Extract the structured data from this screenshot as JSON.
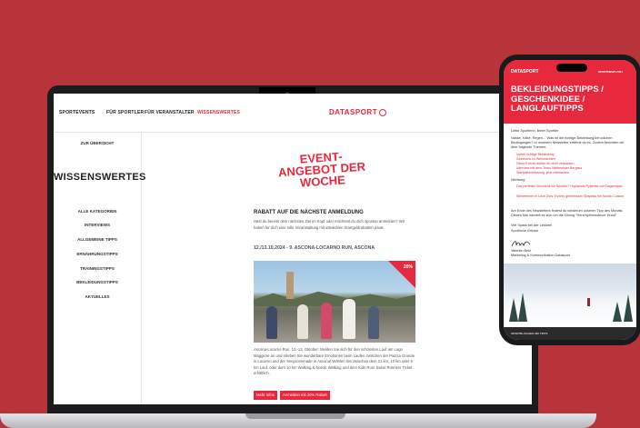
{
  "laptop": {
    "nav": {
      "items": [
        "SPORTEVENTS",
        "FÜR SPORTLER",
        "FÜR VERANSTALTER",
        "WISSENSWERTES"
      ],
      "active_index": 3,
      "logo_text": "DATASPORT"
    },
    "sidebar": {
      "back_link": "ZUR ÜBERSICHT",
      "title": "WISSENSWERTES",
      "items": [
        "ALLE KATEGORIEN",
        "INTERVIEWS",
        "ALLGEMEINE TIPPS",
        "ERNÄHRUNGSTIPPS",
        "TRAININGSTIPPS",
        "BEKLEIDUNGSTIPPS",
        "AKTUELLES"
      ]
    },
    "main": {
      "hero": "EVENT-ANGEBOT DER WOCHE",
      "section_title": "RABATT AUF DIE NÄCHSTE ANMELDUNG",
      "intro": "Hast du bereits dein nächstes Ziel im Kopf oder möchtest du dich spontan anmelden? Wir haben für dich eine tolle Veranstaltung mit attraktiven Startgeldrabatten parat.",
      "event_title": "12./13.10.2024 - 9. ASCONA-LOCARNO RUN, ASCONA",
      "discount_badge": "20%",
      "event_text": "Ascona-Locarno Run, 12.-13. Oktober: Melden Sie sich für den schönsten Lauf am Lago Maggiore an und erleben Sie wunderbare Emotionen beim Laufen zwischen der Piazza Grande in Locarno und der Seepromenade in Ascona! Wählen Sie zwischen dem 21 km, 10 km oder 5 km Lauf, oder dem 10 km Walking & Nordic Walking und dem Kids Run! Swiss Runners Ticket erhältlich.",
      "buttons": [
        "Mehr Infos",
        "Anmelden mit 20% Rabatt"
      ]
    }
  },
  "phone": {
    "logo_text": "DATASPORT",
    "header_right": "SPORTNEWS 2024",
    "title": "BEKLEIDUNGSTIPPS / GESCHENKIDEE / LANGLAUFTIPPS",
    "greeting": "Liebe Sportlerin, lieber Sportler",
    "intro": "Nässe, Kälte, Regen… Was ist die richtige Bekleidung bei solchen Bedingungen? In unserem Newsletter erfährst du es. Zudem berichten wir über folgende Themen:",
    "topics": [
      "Vorteil richtige Bekleidung",
      "Geschenk zu Weihnachten",
      "Diese Events dürfen du nicht verpassen",
      "Interview mit dem Team-Weltmeister Berglauf",
      "Startplatzverlosung: jetzt mitmachen"
    ],
    "ads_label": "Werbung",
    "ads": [
      "Das perfekte Geschenk für Sportler? Highlands-Pyjamas von Dagsmejan!",
      "Winterferien in Lech Zürs: Events gemeinsam Skispass mit Nordic Cuisine"
    ],
    "closing": "Am Ende des Newsletters findest du wiederum unseren Tipp des Monats. Diesen Mal handelt es sich um die Übung \"Herzrhythmusfeuer Hund\".",
    "wish": "Viel Spass bei der Lektüre!",
    "regards": "Sportliche Grüsse",
    "signature": "Valentin Betz",
    "role": "Marketing & Kommunikation Datasport",
    "footer": "SPORTBLOGGEN 360 TIPPS"
  },
  "colors": {
    "background": "#b8343a",
    "accent": "#e8283c"
  }
}
